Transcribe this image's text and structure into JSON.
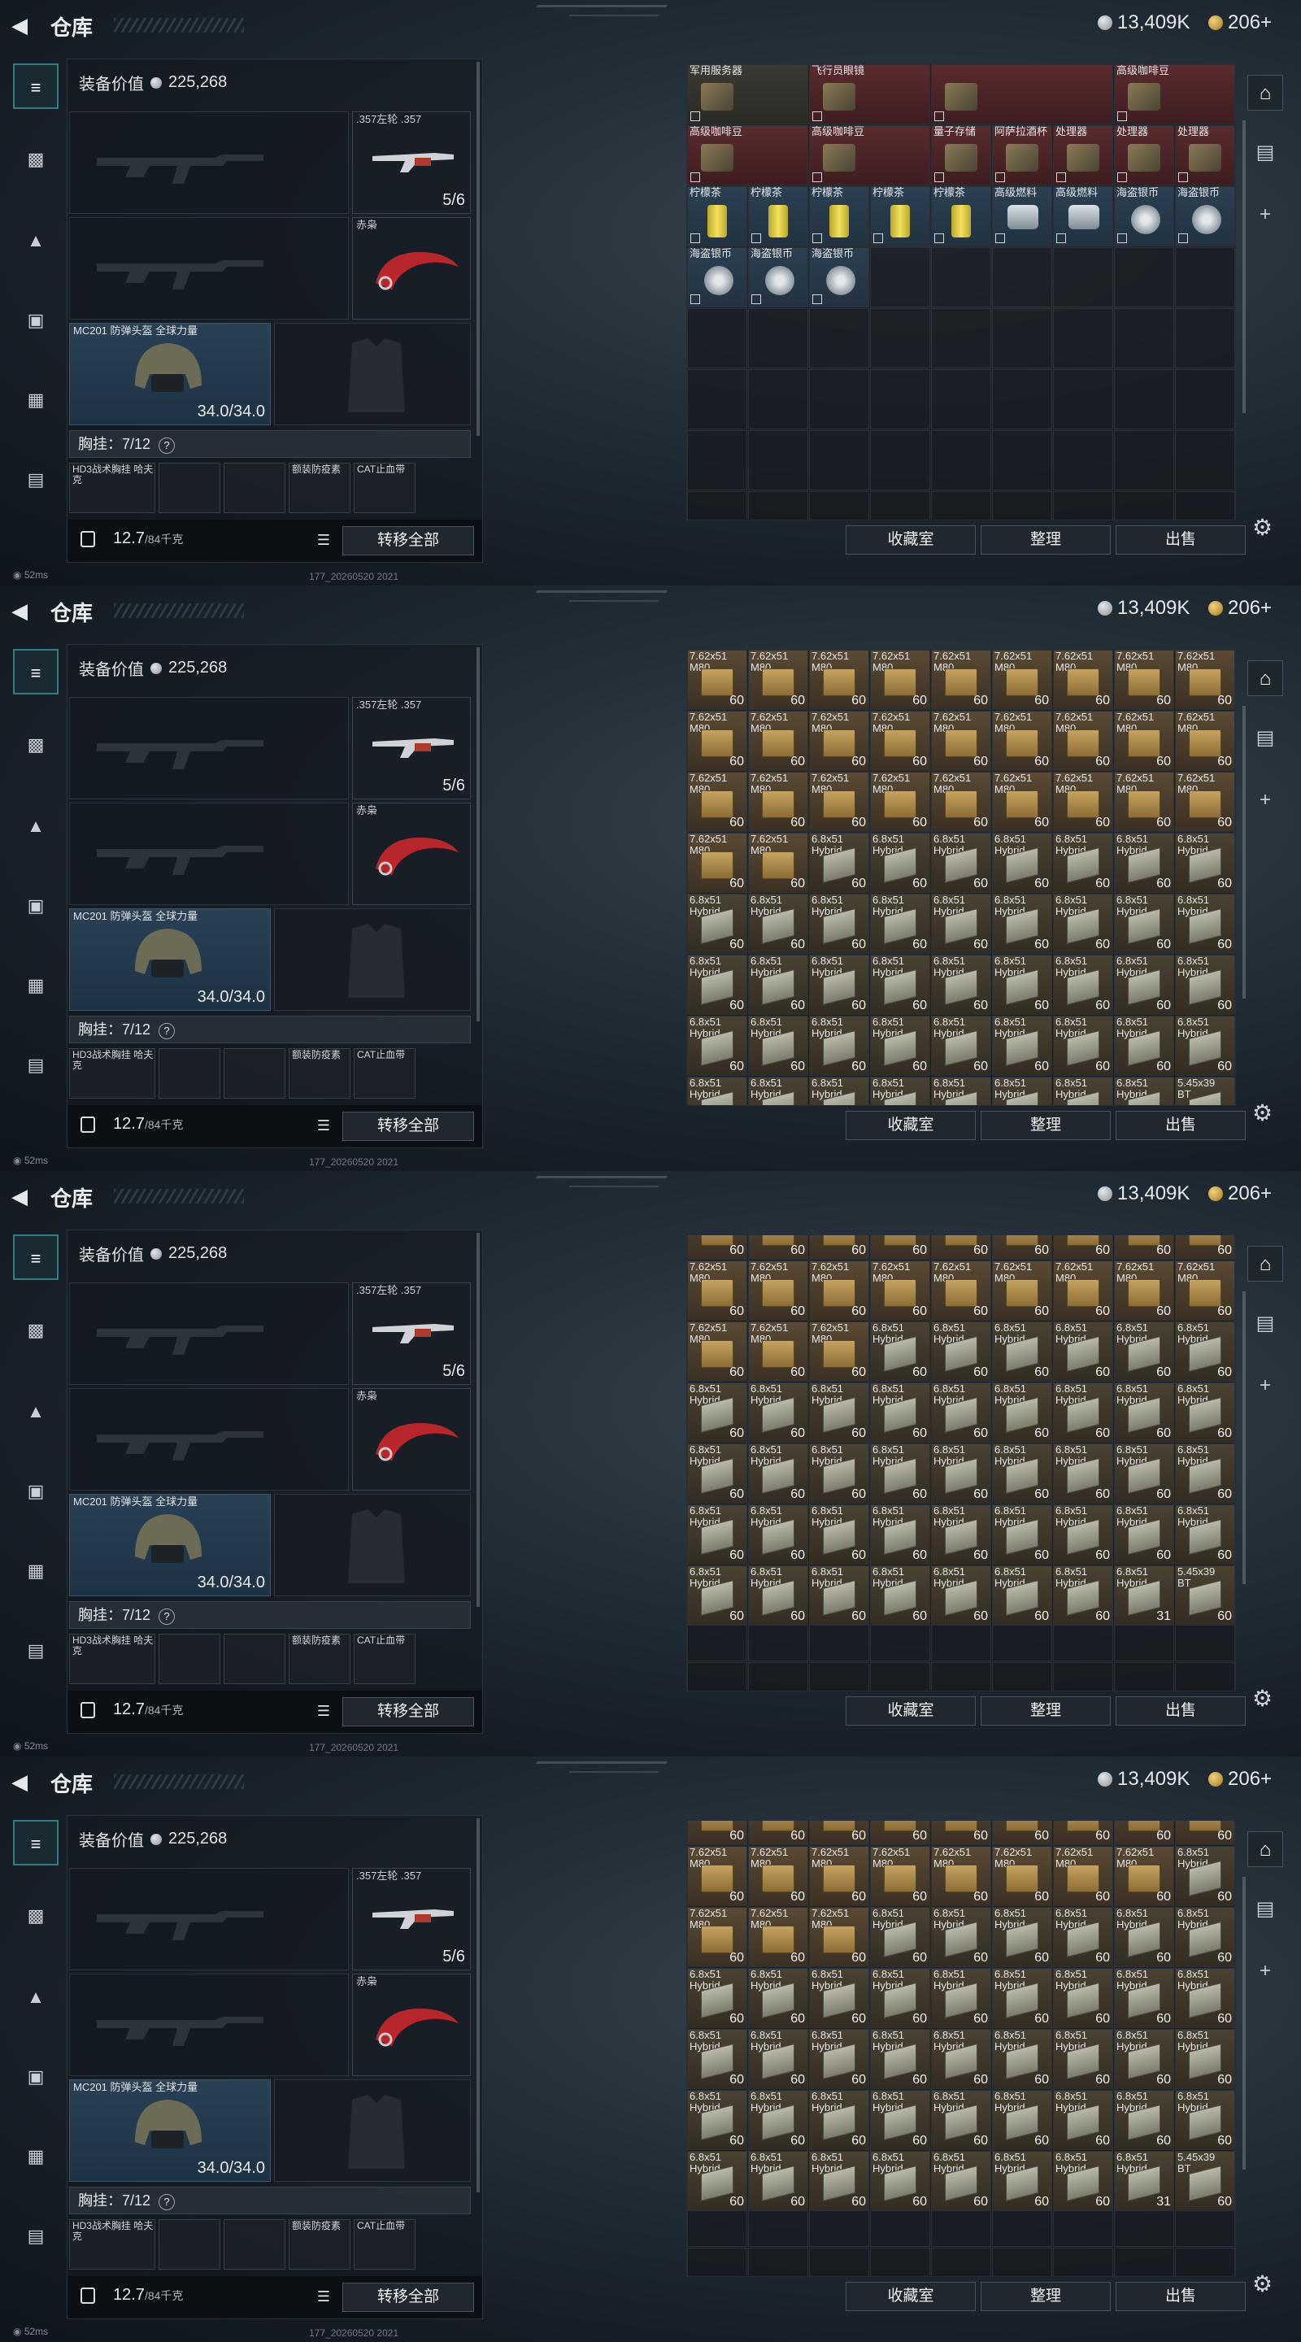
{
  "header": {
    "title": "仓库",
    "silver": "13,409K",
    "gold": "206+"
  },
  "left": {
    "equip_value_label": "装备价值",
    "equip_value": "225,268",
    "revolver_label": ".357左轮 .357",
    "revolver_count": "5/6",
    "knife_label": "赤枭",
    "helmet_label": "MC201 防弹头盔 全球力量",
    "helmet_durability": "34.0/34.0",
    "chest_label": "胸挂：",
    "chest_capacity": "7/12",
    "chest_q": "?",
    "pouch1": "HD3战术胸挂 哈夫克",
    "pouch2": "额装防疫素",
    "pouch3": "CAT止血带",
    "weight": "12.7",
    "weight_unit": "/84千克",
    "transfer_all": "转移全部"
  },
  "status": {
    "ping": "52ms",
    "build": "177_20260520 2021"
  },
  "actions": {
    "collection": "收藏室",
    "sort": "整理",
    "sell": "出售"
  },
  "frame1": [
    {
      "c": 0,
      "r": 0,
      "l": "军用服务器",
      "t": "g"
    },
    {
      "c": 2,
      "r": 0,
      "l": "飞行员眼镜",
      "t": "r"
    },
    {
      "c": 4,
      "r": 0,
      "l": "",
      "t": "r"
    },
    {
      "c": 7,
      "r": 0,
      "l": "高级咖啡豆",
      "t": "r"
    },
    {
      "c": 0,
      "r": 1,
      "l": "高级咖啡豆",
      "t": "r"
    },
    {
      "c": 2,
      "r": 1,
      "l": "高级咖啡豆",
      "t": "r"
    },
    {
      "c": 4,
      "r": 1,
      "l": "量子存储",
      "t": "r"
    },
    {
      "c": 5,
      "r": 1,
      "l": "阿萨拉酒杯",
      "t": "r"
    },
    {
      "c": 6,
      "r": 1,
      "l": "处理器",
      "t": "r"
    },
    {
      "c": 7,
      "r": 1,
      "l": "处理器",
      "t": "r"
    },
    {
      "c": 8,
      "r": 1,
      "l": "处理器",
      "t": "r"
    },
    {
      "c": 0,
      "r": 2,
      "l": "柠檬茶",
      "t": "b",
      "ic": "can"
    },
    {
      "c": 1,
      "r": 2,
      "l": "柠檬茶",
      "t": "b",
      "ic": "can"
    },
    {
      "c": 2,
      "r": 2,
      "l": "柠檬茶",
      "t": "b",
      "ic": "can"
    },
    {
      "c": 3,
      "r": 2,
      "l": "柠檬茶",
      "t": "b",
      "ic": "can"
    },
    {
      "c": 4,
      "r": 2,
      "l": "柠檬茶",
      "t": "b",
      "ic": "can"
    },
    {
      "c": 5,
      "r": 2,
      "l": "高级燃料",
      "t": "b",
      "ic": "canister"
    },
    {
      "c": 6,
      "r": 2,
      "l": "高级燃料",
      "t": "b",
      "ic": "canister"
    },
    {
      "c": 7,
      "r": 2,
      "l": "海盗银币",
      "t": "b",
      "ic": "coinicon"
    },
    {
      "c": 8,
      "r": 2,
      "l": "海盗银币",
      "t": "b",
      "ic": "coinicon"
    },
    {
      "c": 0,
      "r": 3,
      "l": "海盗银币",
      "t": "b",
      "ic": "coinicon"
    },
    {
      "c": 1,
      "r": 3,
      "l": "海盗银币",
      "t": "b",
      "ic": "coinicon"
    },
    {
      "c": 2,
      "r": 3,
      "l": "海盗银币",
      "t": "b",
      "ic": "coinicon"
    }
  ],
  "ammo": {
    "a762": "7.62x51 M80",
    "a68": "6.8x51 Hybrid",
    "a545": "5.45x39 BT"
  },
  "frame2": {
    "offset": 0,
    "rows": [
      [
        "a762",
        "a762",
        "a762",
        "a762",
        "a762",
        "a762",
        "a762",
        "a762",
        "a762"
      ],
      [
        "a762",
        "a762",
        "a762",
        "a762",
        "a762",
        "a762",
        "a762",
        "a762",
        "a762"
      ],
      [
        "a762",
        "a762",
        "a762",
        "a762",
        "a762",
        "a762",
        "a762",
        "a762",
        "a762"
      ],
      [
        "a762",
        "a762",
        "a68",
        "a68",
        "a68",
        "a68",
        "a68",
        "a68",
        "a68"
      ],
      [
        "a68",
        "a68",
        "a68",
        "a68",
        "a68",
        "a68",
        "a68",
        "a68",
        "a68"
      ],
      [
        "a68",
        "a68",
        "a68",
        "a68",
        "a68",
        "a68",
        "a68",
        "a68",
        "a68"
      ],
      [
        "a68",
        "a68",
        "a68",
        "a68",
        "a68",
        "a68",
        "a68",
        "a68",
        "a68"
      ],
      [
        "a68",
        "a68",
        "a68",
        "a68",
        "a68",
        "a68",
        "a68",
        "a68",
        "a545"
      ]
    ]
  },
  "frame3": {
    "offset": -44,
    "rows": [
      [
        "a762",
        "a762",
        "a762",
        "a762",
        "a762",
        "a762",
        "a762",
        "a762",
        "a762"
      ],
      [
        "a762",
        "a762",
        "a762",
        "a762",
        "a762",
        "a762",
        "a762",
        "a762",
        "a762"
      ],
      [
        "a762",
        "a762",
        "a762",
        "a68",
        "a68",
        "a68",
        "a68",
        "a68",
        "a68"
      ],
      [
        "a68",
        "a68",
        "a68",
        "a68",
        "a68",
        "a68",
        "a68",
        "a68",
        "a68"
      ],
      [
        "a68",
        "a68",
        "a68",
        "a68",
        "a68",
        "a68",
        "a68",
        "a68",
        "a68"
      ],
      [
        "a68",
        "a68",
        "a68",
        "a68",
        "a68",
        "a68",
        "a68",
        "a68",
        "a68"
      ],
      [
        "a68",
        "a68",
        "a68",
        "a68",
        "a68",
        "a68",
        "a68",
        "a68#31",
        "a545"
      ]
    ]
  },
  "frame4": {
    "offset": -44,
    "rows": [
      [
        "a762",
        "a762",
        "a762",
        "a762",
        "a762",
        "a762",
        "a762",
        "a762",
        "a762"
      ],
      [
        "a762",
        "a762",
        "a762",
        "a762",
        "a762",
        "a762",
        "a762",
        "a762",
        "a68"
      ],
      [
        "a762",
        "a762",
        "a762",
        "a68",
        "a68",
        "a68",
        "a68",
        "a68",
        "a68"
      ],
      [
        "a68",
        "a68",
        "a68",
        "a68",
        "a68",
        "a68",
        "a68",
        "a68",
        "a68"
      ],
      [
        "a68",
        "a68",
        "a68",
        "a68",
        "a68",
        "a68",
        "a68",
        "a68",
        "a68"
      ],
      [
        "a68",
        "a68",
        "a68",
        "a68",
        "a68",
        "a68",
        "a68",
        "a68",
        "a68"
      ],
      [
        "a68",
        "a68",
        "a68",
        "a68",
        "a68",
        "a68",
        "a68",
        "a68#31",
        "a545"
      ]
    ]
  },
  "stack_full": "60",
  "stack_31": "31"
}
